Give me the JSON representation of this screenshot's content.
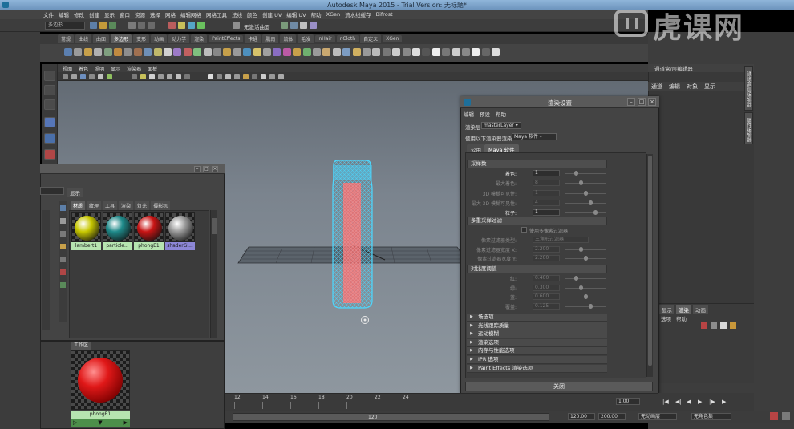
{
  "app": {
    "title": "Autodesk Maya 2015 - Trial Version: 无标题*",
    "menus": [
      "文件",
      "编辑",
      "修改",
      "创建",
      "显示",
      "窗口",
      "资源",
      "选择",
      "网格",
      "编辑网格",
      "网格工具",
      "法线",
      "颜色",
      "创建 UV",
      "编辑 UV",
      "帮助",
      "XGen",
      "流水线缓存",
      "Bifrost"
    ],
    "menu_set": "多边形",
    "status": {
      "no_live_surface": "无激活曲面"
    }
  },
  "watermark": {
    "text": "虎课网"
  },
  "shelf": {
    "tabs": [
      "常规",
      "曲线",
      "曲面",
      "多边形",
      "变形",
      "动画",
      "动力学",
      "渲染",
      "PaintEffects",
      "卡通",
      "肌肉",
      "流体",
      "毛发",
      "nHair",
      "nCloth",
      "自定义",
      "XGen"
    ],
    "active_tab": "多边形"
  },
  "viewport": {
    "menus": [
      "视图",
      "着色",
      "照明",
      "显示",
      "渲染器",
      "面板"
    ]
  },
  "channel_box": {
    "header": "通道盒/层编辑器",
    "menus": [
      "通道",
      "编辑",
      "对象",
      "显示"
    ],
    "side_tabs": [
      "通道盒/层编辑器",
      "属性编辑器"
    ],
    "layer_tabs": [
      "显示",
      "渲染",
      "动画"
    ],
    "layer_menus": [
      "选项",
      "帮助"
    ]
  },
  "render_settings": {
    "title": "渲染设置",
    "menus": [
      "编辑",
      "预设",
      "帮助"
    ],
    "render_layer_label": "渲染层",
    "render_layer_value": "masterLayer",
    "renderer_label": "使用以下渲染器渲染",
    "renderer_value": "Maya 软件",
    "tabs": [
      "公用",
      "Maya 软件"
    ],
    "active_tab": "Maya 软件",
    "sections": {
      "sampling": {
        "title": "采样数",
        "rows": [
          {
            "label": "着色:",
            "value": "1",
            "dim": false
          },
          {
            "label": "最大着色:",
            "value": "8",
            "dim": true
          },
          {
            "label": "3D 模糊可见性:",
            "value": "1",
            "dim": true
          },
          {
            "label": "最大 3D 模糊可见性:",
            "value": "4",
            "dim": true
          },
          {
            "label": "粒子:",
            "value": "1",
            "dim": false
          }
        ]
      },
      "multipixel": {
        "title": "多重采样过滤",
        "checkbox": "使用多像素过滤器",
        "rows": [
          {
            "label": "像素过滤器类型:",
            "value": "三角形过滤器"
          },
          {
            "label": "像素过滤器宽度 X:",
            "value": "2.200"
          },
          {
            "label": "像素过滤器宽度 Y:",
            "value": "2.200"
          }
        ]
      },
      "contrast": {
        "title": "对比度阈值",
        "rows": [
          {
            "label": "红:",
            "value": "0.400"
          },
          {
            "label": "绿:",
            "value": "0.300"
          },
          {
            "label": "蓝:",
            "value": "0.600"
          },
          {
            "label": "覆盖:",
            "value": "0.125"
          }
        ]
      }
    },
    "collapsed": [
      "场选项",
      "光线跟踪质量",
      "运动模糊",
      "渲染选项",
      "内存与性能选项",
      "IPR 选项",
      "Paint Effects 渲染选项"
    ],
    "close_label": "关闭"
  },
  "material_browser": {
    "filter_button": "显示",
    "tabs": [
      "材质",
      "纹理",
      "工具",
      "渲染",
      "灯光",
      "摄影机"
    ],
    "active_tab": "材质",
    "materials": [
      {
        "name": "lambert1",
        "color": "#c8c800"
      },
      {
        "name": "particle...",
        "color": "#1f8a8a"
      },
      {
        "name": "phongE1",
        "color": "#c81414"
      },
      {
        "name": "shaderGl...",
        "color": "#9a9a9a"
      }
    ],
    "work_area": {
      "tab": "工作区",
      "material": "phongE1"
    }
  },
  "timeline": {
    "ticks": [
      "12",
      "14",
      "16",
      "18",
      "20",
      "22",
      "24"
    ],
    "current_frame": "1.00",
    "range_value": "120",
    "end_time": "120.00",
    "max_time": "200.00",
    "anim_layer": "无动画层",
    "char_set": "无角色集"
  },
  "colors": {
    "wireframe": "#4cd8ff",
    "shader_red": "#ff6d6d",
    "grid": "#3d4046"
  }
}
